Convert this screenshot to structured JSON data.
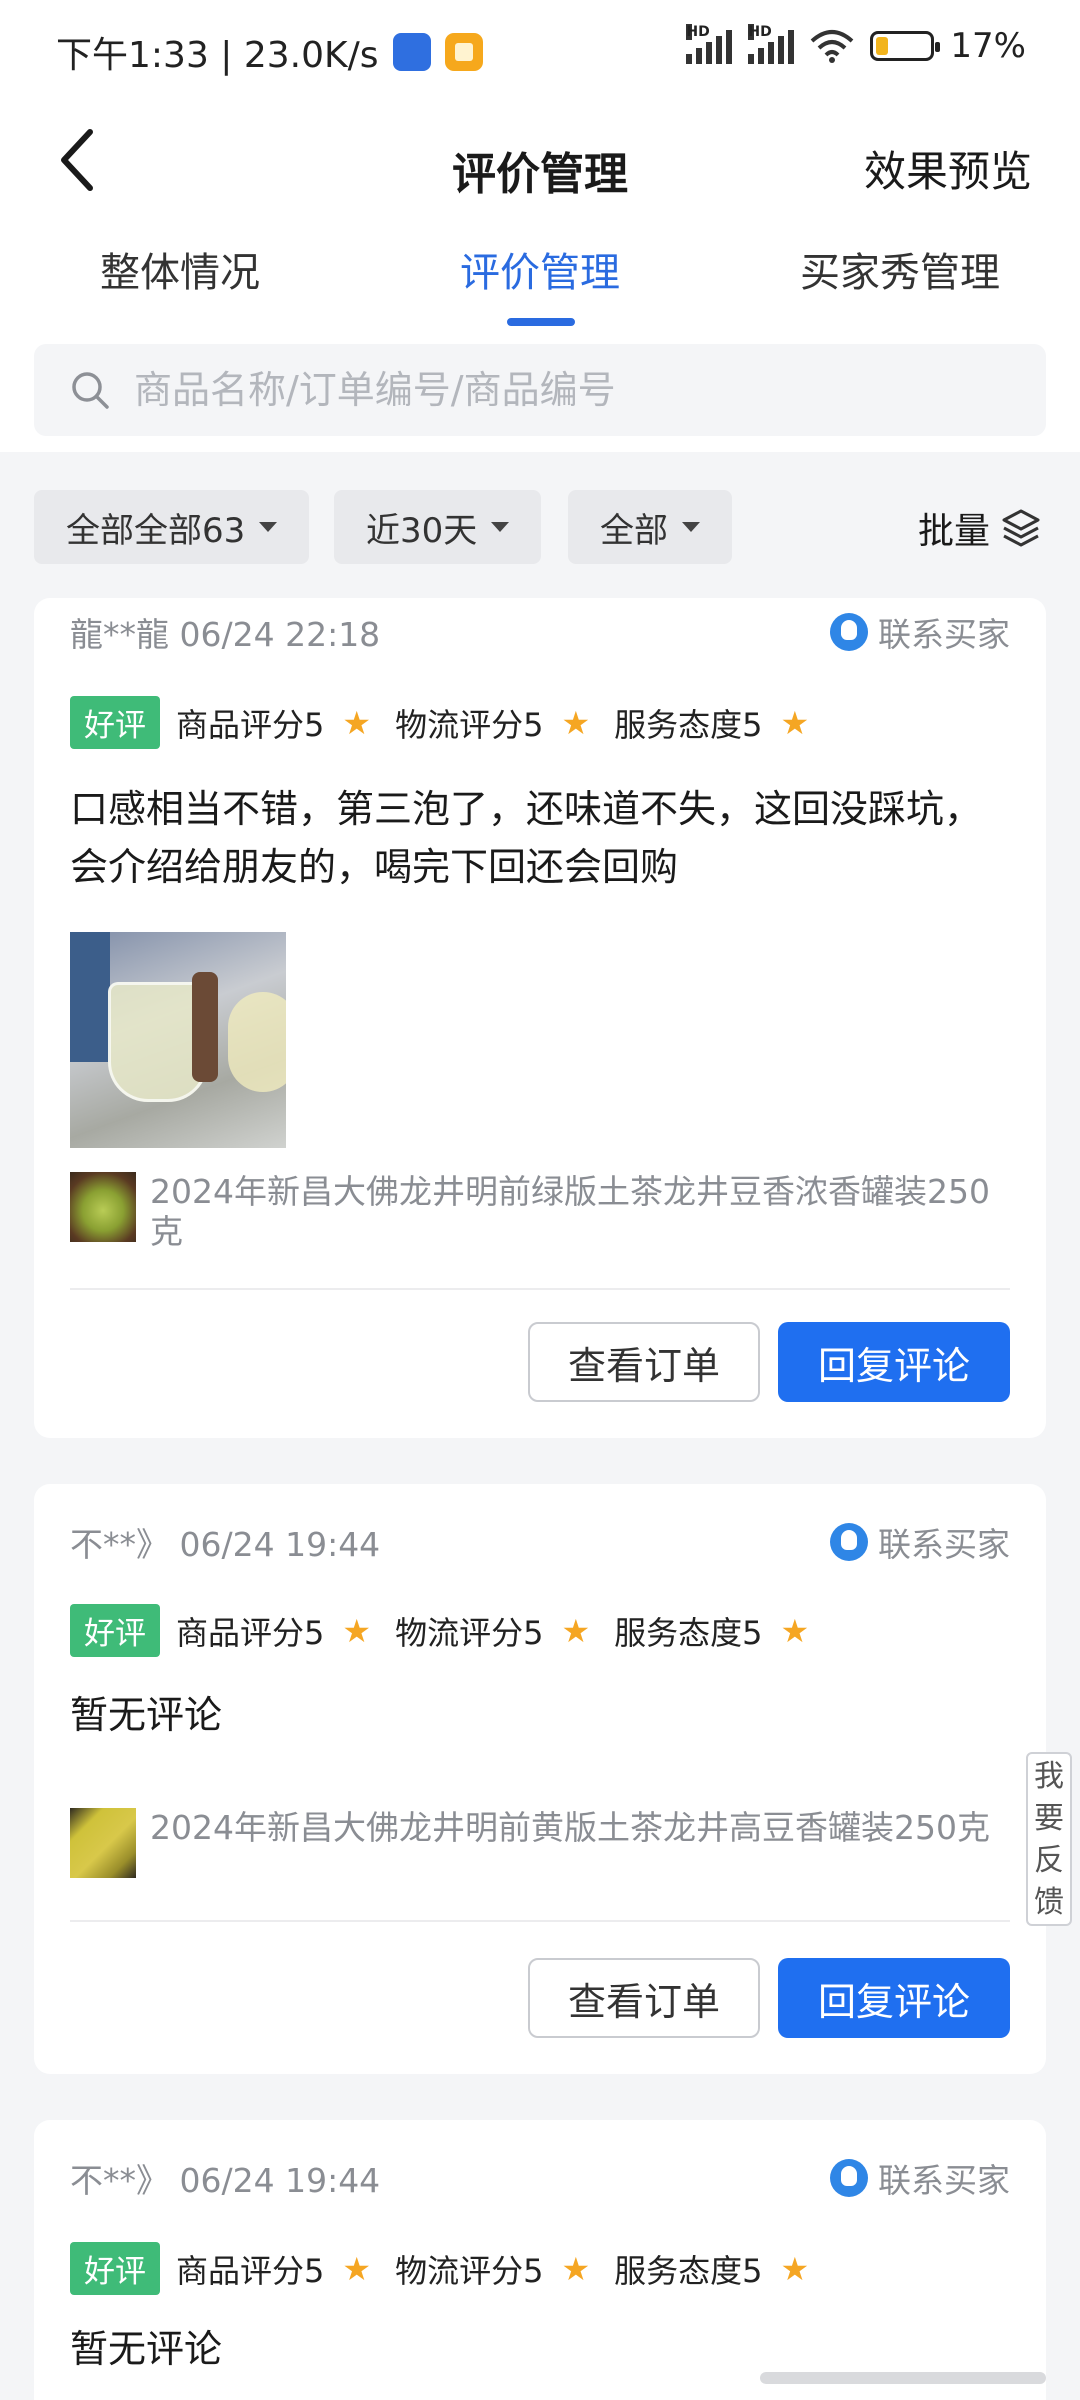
{
  "status_bar": {
    "time_speed": "下午1:33 | 23.0K/s",
    "battery": "17%",
    "signal_label": "HD"
  },
  "header": {
    "title": "评价管理",
    "preview": "效果预览"
  },
  "tabs": [
    {
      "label": "整体情况"
    },
    {
      "label": "评价管理"
    },
    {
      "label": "买家秀管理"
    }
  ],
  "search": {
    "placeholder": "商品名称/订单编号/商品编号"
  },
  "filters": {
    "chips": [
      "全部全部63",
      "近30天",
      "全部"
    ],
    "batch": "批量"
  },
  "reviews": [
    {
      "user": "龍**龍 06/24 22:18",
      "contact": "联系买家",
      "badge": "好评",
      "ratings": [
        "商品评分5",
        "物流评分5",
        "服务态度5"
      ],
      "text": "口感相当不错，第三泡了，还味道不失，这回没踩坑，会介绍给朋友的，喝完下回还会回购",
      "product": "2024年新昌大佛龙井明前绿版土茶龙井豆香浓香罐装250克",
      "btn_order": "查看订单",
      "btn_reply": "回复评论"
    },
    {
      "user": "不**》 06/24 19:44",
      "contact": "联系买家",
      "badge": "好评",
      "ratings": [
        "商品评分5",
        "物流评分5",
        "服务态度5"
      ],
      "text": "暂无评论",
      "product": "2024年新昌大佛龙井明前黄版土茶龙井高豆香罐装250克",
      "btn_order": "查看订单",
      "btn_reply": "回复评论"
    },
    {
      "user": "不**》 06/24 19:44",
      "contact": "联系买家",
      "badge": "好评",
      "ratings": [
        "商品评分5",
        "物流评分5",
        "服务态度5"
      ],
      "text": "暂无评论"
    }
  ],
  "feedback": "我要反馈",
  "icons": {
    "back": "chevron-left-icon",
    "search": "search-icon",
    "batch": "layers-icon",
    "contact": "qq-penguin-icon",
    "star": "star-icon"
  },
  "colors": {
    "accent": "#2a6be0",
    "primary_button": "#1f6ff0",
    "good_badge": "#3fbb78",
    "star": "#f5a623"
  }
}
